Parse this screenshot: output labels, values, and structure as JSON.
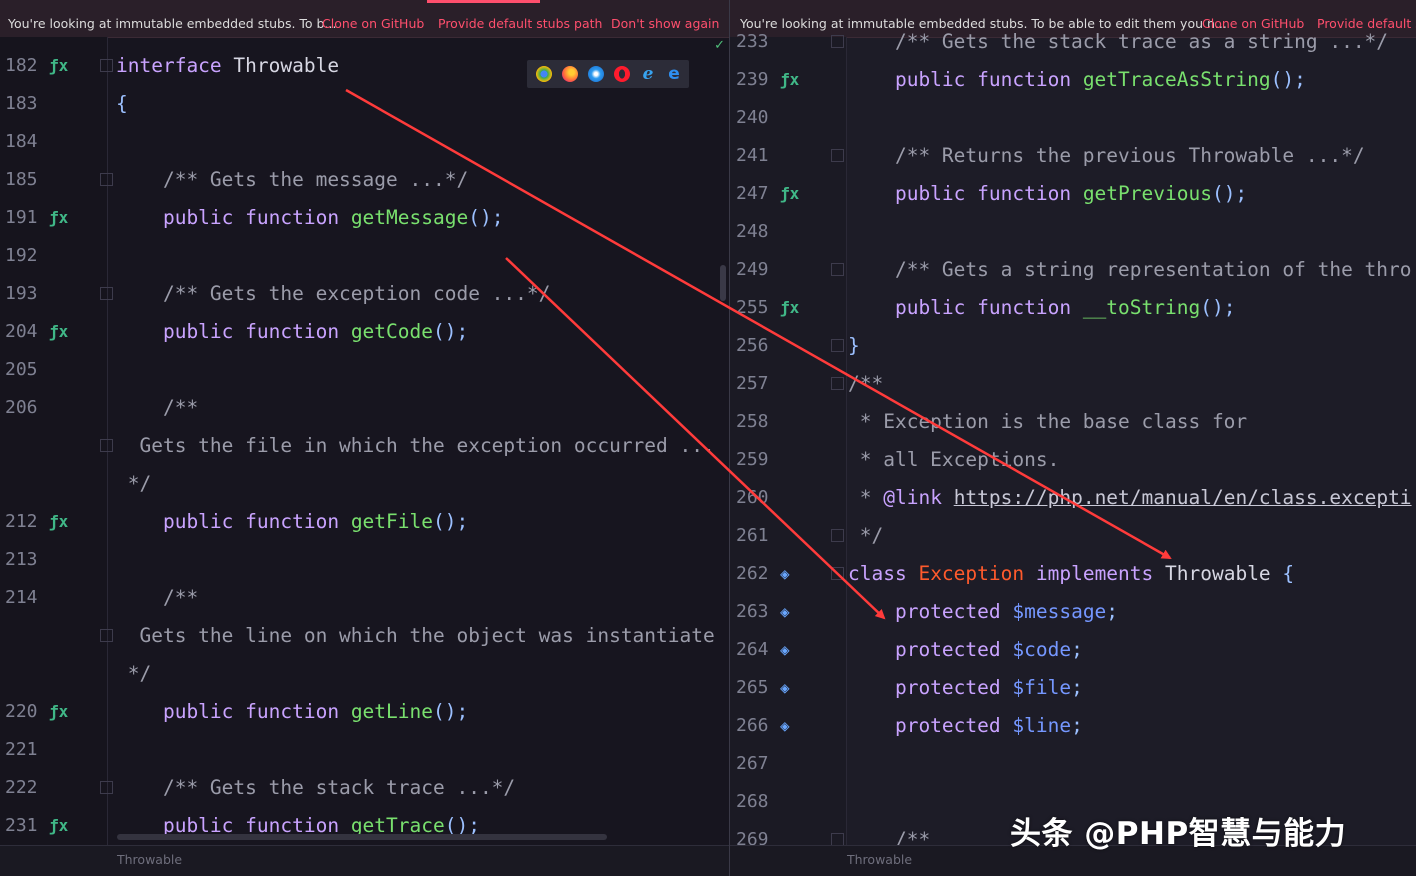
{
  "left_pane": {
    "banner": {
      "message": "You're looking at immutable embedded stubs. To b...",
      "links": [
        "Clone on GitHub",
        "Provide default stubs path",
        "Don't show again"
      ]
    },
    "status_text": "Throwable",
    "lines": [
      {
        "n": "182",
        "mark": "fx",
        "fold": true,
        "tokens": [
          [
            "kw",
            "interface"
          ],
          [
            "t",
            " Throwable"
          ]
        ]
      },
      {
        "n": "183",
        "tokens": [
          [
            "pn",
            "{"
          ]
        ]
      },
      {
        "n": "184",
        "tokens": []
      },
      {
        "n": "185",
        "fold": true,
        "tokens": [
          [
            "cm",
            "    /** Gets the message ...*/"
          ]
        ]
      },
      {
        "n": "191",
        "mark": "fx",
        "tokens": [
          [
            "kw",
            "    public function "
          ],
          [
            "fn",
            "getMessage"
          ],
          [
            "pn",
            "();"
          ]
        ]
      },
      {
        "n": "192",
        "tokens": []
      },
      {
        "n": "193",
        "fold": true,
        "tokens": [
          [
            "cm",
            "    /** Gets the exception code ...*/"
          ]
        ]
      },
      {
        "n": "204",
        "mark": "fx",
        "tokens": [
          [
            "kw",
            "    public function "
          ],
          [
            "fn",
            "getCode"
          ],
          [
            "pn",
            "();"
          ]
        ]
      },
      {
        "n": "205",
        "tokens": []
      },
      {
        "n": "206",
        "tokens": [
          [
            "cm",
            "    /**"
          ]
        ]
      },
      {
        "n": "",
        "fold": true,
        "tokens": [
          [
            "cm",
            "  Gets the file in which the exception occurred ..."
          ]
        ]
      },
      {
        "n": "",
        "tokens": [
          [
            "cm",
            " */"
          ]
        ]
      },
      {
        "n": "212",
        "mark": "fx",
        "tokens": [
          [
            "kw",
            "    public function "
          ],
          [
            "fn",
            "getFile"
          ],
          [
            "pn",
            "();"
          ]
        ]
      },
      {
        "n": "213",
        "tokens": []
      },
      {
        "n": "214",
        "tokens": [
          [
            "cm",
            "    /**"
          ]
        ]
      },
      {
        "n": "",
        "fold": true,
        "tokens": [
          [
            "cm",
            "  Gets the line on which the object was instantiate"
          ]
        ]
      },
      {
        "n": "",
        "tokens": [
          [
            "cm",
            " */"
          ]
        ]
      },
      {
        "n": "220",
        "mark": "fx",
        "tokens": [
          [
            "kw",
            "    public function "
          ],
          [
            "fn",
            "getLine"
          ],
          [
            "pn",
            "();"
          ]
        ]
      },
      {
        "n": "221",
        "tokens": []
      },
      {
        "n": "222",
        "fold": true,
        "tokens": [
          [
            "cm",
            "    /** Gets the stack trace ...*/"
          ]
        ]
      },
      {
        "n": "231",
        "mark": "fx",
        "tokens": [
          [
            "kw",
            "    public function "
          ],
          [
            "fn",
            "getTrace"
          ],
          [
            "pn",
            "();"
          ]
        ]
      }
    ]
  },
  "right_pane": {
    "banner": {
      "message": "You're looking at immutable embedded stubs. To be able to edit them you n...",
      "links": [
        "Clone on GitHub",
        "Provide default s"
      ]
    },
    "status_text": "Throwable",
    "lines": [
      {
        "n": "233",
        "fold": true,
        "tokens": [
          [
            "cm",
            "    /** Gets the stack trace as a string ...*/"
          ]
        ]
      },
      {
        "n": "239",
        "mark": "fx",
        "tokens": [
          [
            "kw",
            "    public function "
          ],
          [
            "fn",
            "getTraceAsString"
          ],
          [
            "pn",
            "();"
          ]
        ]
      },
      {
        "n": "240",
        "tokens": []
      },
      {
        "n": "241",
        "fold": true,
        "tokens": [
          [
            "cm",
            "    /** Returns the previous Throwable ...*/"
          ]
        ]
      },
      {
        "n": "247",
        "mark": "fx",
        "tokens": [
          [
            "kw",
            "    public function "
          ],
          [
            "fn",
            "getPrevious"
          ],
          [
            "pn",
            "();"
          ]
        ]
      },
      {
        "n": "248",
        "tokens": []
      },
      {
        "n": "249",
        "fold": true,
        "tokens": [
          [
            "cm",
            "    /** Gets a string representation of the thro"
          ]
        ]
      },
      {
        "n": "255",
        "mark": "fx",
        "tokens": [
          [
            "kw",
            "    public function "
          ],
          [
            "fn",
            "__toString"
          ],
          [
            "pn",
            "();"
          ]
        ]
      },
      {
        "n": "256",
        "fold": true,
        "tokens": [
          [
            "pn",
            "}"
          ]
        ]
      },
      {
        "n": "257",
        "fold": true,
        "tokens": [
          [
            "cm",
            "/**"
          ]
        ]
      },
      {
        "n": "258",
        "tokens": [
          [
            "cm",
            " * Exception is the base class for"
          ]
        ]
      },
      {
        "n": "259",
        "tokens": [
          [
            "cm",
            " * all Exceptions."
          ]
        ]
      },
      {
        "n": "260",
        "tokens": [
          [
            "cm",
            " * "
          ],
          [
            "kw",
            "@link "
          ],
          [
            "ul",
            "https://php.net/manual/en/class.excepti"
          ]
        ]
      },
      {
        "n": "261",
        "fold": true,
        "tokens": [
          [
            "cm",
            " */"
          ]
        ]
      },
      {
        "n": "262",
        "mark": "prop",
        "fold": true,
        "tokens": [
          [
            "kw",
            "class "
          ],
          [
            "kwr",
            "Exception"
          ],
          [
            "kw",
            " implements "
          ],
          [
            "t",
            "Throwable "
          ],
          [
            "pn",
            "{"
          ]
        ]
      },
      {
        "n": "263",
        "mark": "prop",
        "tokens": [
          [
            "kw",
            "    protected "
          ],
          [
            "vr",
            "$message"
          ],
          [
            "pn",
            ";"
          ]
        ]
      },
      {
        "n": "264",
        "mark": "prop",
        "tokens": [
          [
            "kw",
            "    protected "
          ],
          [
            "vr",
            "$code"
          ],
          [
            "pn",
            ";"
          ]
        ]
      },
      {
        "n": "265",
        "mark": "prop",
        "tokens": [
          [
            "kw",
            "    protected "
          ],
          [
            "vr",
            "$file"
          ],
          [
            "pn",
            ";"
          ]
        ]
      },
      {
        "n": "266",
        "mark": "prop",
        "tokens": [
          [
            "kw",
            "    protected "
          ],
          [
            "vr",
            "$line"
          ],
          [
            "pn",
            ";"
          ]
        ]
      },
      {
        "n": "267",
        "tokens": []
      },
      {
        "n": "268",
        "tokens": []
      },
      {
        "n": "269",
        "fold": true,
        "tokens": [
          [
            "cm",
            "    /**"
          ]
        ]
      }
    ]
  },
  "browser_icons": [
    "chrome-icon",
    "firefox-icon",
    "safari-icon",
    "opera-icon",
    "ie-icon",
    "edge-icon"
  ],
  "watermark": "头条 @PHP智慧与能力",
  "colors": {
    "keyword": "#c9a3ff",
    "function": "#79e06e",
    "variable": "#7597ff",
    "class_name": "#ff5a2c",
    "comment": "#9b9caa",
    "banner_link": "#ff4f6d",
    "arrow": "#ff3b3b"
  }
}
